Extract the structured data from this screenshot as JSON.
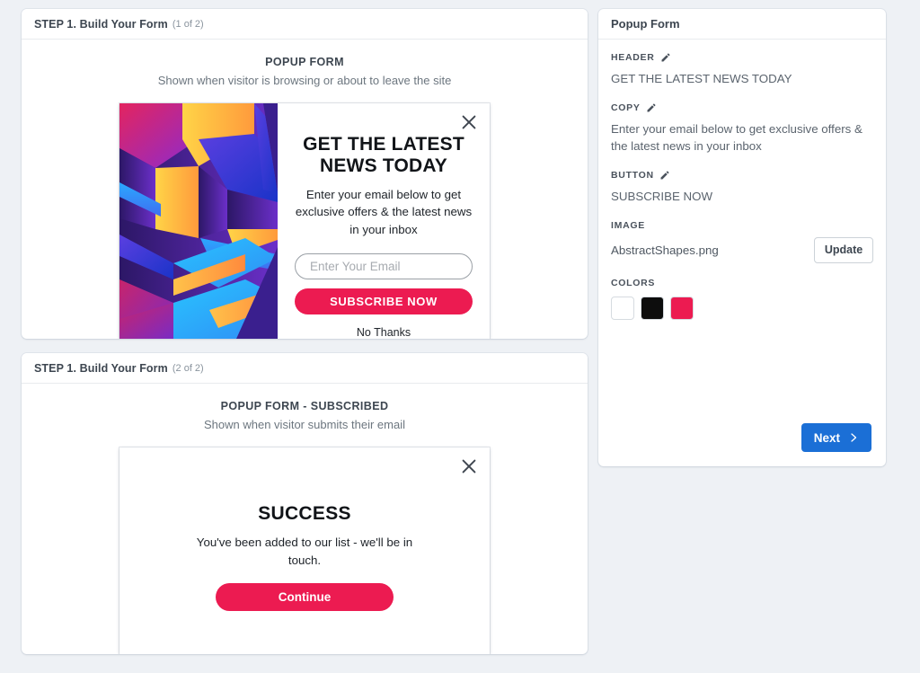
{
  "cards": [
    {
      "step_title": "STEP 1. Build Your Form",
      "step_count": "(1 of 2)",
      "preview_title": "POPUP FORM",
      "preview_sub": "Shown when visitor is browsing or about to leave the site"
    },
    {
      "step_title": "STEP 1. Build Your Form",
      "step_count": "(2 of 2)",
      "preview_title": "POPUP FORM - SUBSCRIBED",
      "preview_sub": "Shown when visitor submits their email"
    }
  ],
  "popup": {
    "close_icon": "close-icon",
    "header": "GET THE LATEST NEWS TODAY",
    "copy": "Enter your email below to get exclusive offers & the latest news in your inbox",
    "email_placeholder": "Enter Your Email",
    "email_value": "",
    "cta_label": "SUBSCRIBE NOW",
    "decline_label": "No Thanks",
    "cta_color": "#ec1b51"
  },
  "success": {
    "close_icon": "close-icon",
    "header": "SUCCESS",
    "copy": "You've been added to our list - we'll be in touch.",
    "cta_label": "Continue",
    "cta_color": "#ec1b51"
  },
  "side_panel": {
    "title": "Popup Form",
    "fields": [
      {
        "label": "HEADER",
        "edit_icon": "pencil-icon",
        "value": "GET THE LATEST NEWS TODAY"
      },
      {
        "label": "COPY",
        "edit_icon": "pencil-icon",
        "value": "Enter your email below to get exclusive offers & the latest news in your inbox"
      },
      {
        "label": "BUTTON",
        "edit_icon": "pencil-icon",
        "value": "SUBSCRIBE NOW"
      }
    ],
    "image": {
      "label": "IMAGE",
      "filename": "AbstractShapes.png",
      "update_label": "Update"
    },
    "colors": {
      "label": "COLORS",
      "swatches": [
        "#ffffff",
        "#0d0d0d",
        "#ec1b51"
      ]
    },
    "next": {
      "label": "Next",
      "icon": "chevron-right-icon",
      "color": "#1b6fd6"
    }
  }
}
